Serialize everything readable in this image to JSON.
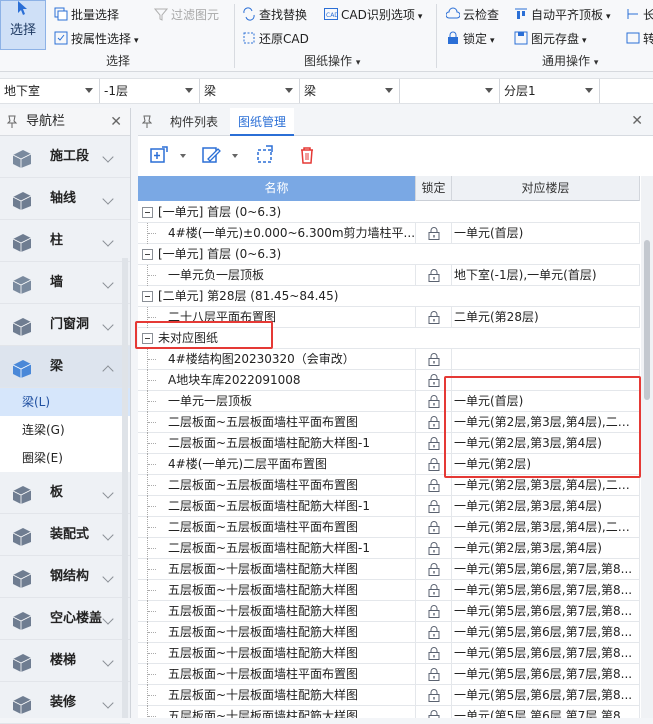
{
  "ribbon": {
    "select_label": "选择",
    "batch_select": "批量选择",
    "filter_shapes": "过滤图元",
    "select_by_attr": "按属性选择",
    "group_select": "选择",
    "find_replace": "查找替换",
    "cad_options": "CAD识别选项",
    "restore_cad": "还原CAD",
    "group_drawing": "图纸操作",
    "cloud_check": "云检查",
    "auto_align": "自动平齐顶板",
    "lock": "锁定",
    "save_shapes": "图元存盘",
    "group_common": "通用操作",
    "extra1": "长",
    "extra2": "转"
  },
  "dropdowns": [
    "地下室",
    "-1层",
    "梁",
    "梁",
    "",
    "分层1"
  ],
  "nav": {
    "title": "导航栏",
    "items": [
      {
        "label": "施工段",
        "icon": "construction-segment-icon"
      },
      {
        "label": "轴线",
        "icon": "axis-grid-icon"
      },
      {
        "label": "柱",
        "icon": "column-icon"
      },
      {
        "label": "墙",
        "icon": "wall-icon"
      },
      {
        "label": "门窗洞",
        "icon": "door-window-icon"
      },
      {
        "label": "梁",
        "icon": "beam-icon"
      },
      {
        "label": "板",
        "icon": "slab-icon"
      },
      {
        "label": "装配式",
        "icon": "prefab-icon"
      },
      {
        "label": "钢结构",
        "icon": "steel-structure-icon"
      },
      {
        "label": "空心楼盖",
        "icon": "hollow-floor-icon"
      },
      {
        "label": "楼梯",
        "icon": "stair-icon"
      },
      {
        "label": "装修",
        "icon": "decoration-icon"
      }
    ],
    "beam_subitems": [
      "梁(L)",
      "连梁(G)",
      "圈梁(E)"
    ]
  },
  "panel": {
    "tabs": [
      "构件列表",
      "图纸管理"
    ],
    "active_tab": "图纸管理",
    "headers": {
      "name": "名称",
      "lock": "锁定",
      "floor": "对应楼层"
    },
    "rows": [
      {
        "type": "group",
        "name": "[一单元] 首层 (0~6.3)",
        "floor": ""
      },
      {
        "type": "item",
        "name": "4#楼(一单元)±0.000~6.300m剪力墙柱平...",
        "floor": "一单元(首层)"
      },
      {
        "type": "group",
        "name": "[一单元] 首层 (0~6.3)",
        "floor": ""
      },
      {
        "type": "item",
        "name": "一单元负一层顶板",
        "floor": "地下室(-1层),一单元(首层)"
      },
      {
        "type": "group",
        "name": "[二单元] 第28层 (81.45~84.45)",
        "floor": ""
      },
      {
        "type": "item",
        "name": "二十八层平面布置图",
        "floor": "二单元(第28层)"
      },
      {
        "type": "group",
        "name": "未对应图纸",
        "floor": ""
      },
      {
        "type": "item",
        "name": "4#楼结构图20230320（会审改）",
        "floor": ""
      },
      {
        "type": "item",
        "name": "A地块车库2022091008",
        "floor": ""
      },
      {
        "type": "item",
        "name": "一单元一层顶板",
        "floor": "一单元(首层)"
      },
      {
        "type": "item",
        "name": "二层板面~五层板面墙柱平面布置图",
        "floor": "一单元(第2层,第3层,第4层),二单..."
      },
      {
        "type": "item",
        "name": "二层板面~五层板面墙柱配筋大样图-1",
        "floor": "一单元(第2层,第3层,第4层)"
      },
      {
        "type": "item",
        "name": "4#楼(一单元)二层平面布置图",
        "floor": "一单元(第2层)"
      },
      {
        "type": "item",
        "name": "二层板面~五层板面墙柱平面布置图",
        "floor": "一单元(第2层,第3层,第4层),二单..."
      },
      {
        "type": "item",
        "name": "二层板面~五层板面墙柱配筋大样图-1",
        "floor": "一单元(第2层,第3层,第4层)"
      },
      {
        "type": "item",
        "name": "二层板面~五层板面墙柱平面布置图",
        "floor": "一单元(第2层,第3层,第4层),二单..."
      },
      {
        "type": "item",
        "name": "二层板面~五层板面墙柱配筋大样图-1",
        "floor": "一单元(第2层,第3层,第4层)"
      },
      {
        "type": "item",
        "name": "五层板面~十层板面墙柱配筋大样图",
        "floor": "一单元(第5层,第6层,第7层,第8..."
      },
      {
        "type": "item",
        "name": "五层板面~十层板面墙柱配筋大样图",
        "floor": "一单元(第5层,第6层,第7层,第8..."
      },
      {
        "type": "item",
        "name": "五层板面~十层板面墙柱配筋大样图",
        "floor": "一单元(第5层,第6层,第7层,第8..."
      },
      {
        "type": "item",
        "name": "五层板面~十层板面墙柱配筋大样图",
        "floor": "一单元(第5层,第6层,第7层,第8..."
      },
      {
        "type": "item",
        "name": "五层板面~十层板面墙柱配筋大样图",
        "floor": "一单元(第5层,第6层,第7层,第8..."
      },
      {
        "type": "item",
        "name": "五层板面~十层板面墙柱平面布置图",
        "floor": "一单元(第5层,第6层,第7层,第8..."
      },
      {
        "type": "item",
        "name": "五层板面~十层板面墙柱配筋大样图",
        "floor": "一单元(第5层,第6层,第7层,第8..."
      },
      {
        "type": "item",
        "name": "五层板面~十层板面墙柱配筋大样图",
        "floor": "一单元(第5层,第6层,第7层,第8..."
      }
    ]
  },
  "colors": {
    "accent": "#2b6fd6",
    "header_name_bg": "#7aa8e4",
    "highlight": "#e53935"
  }
}
